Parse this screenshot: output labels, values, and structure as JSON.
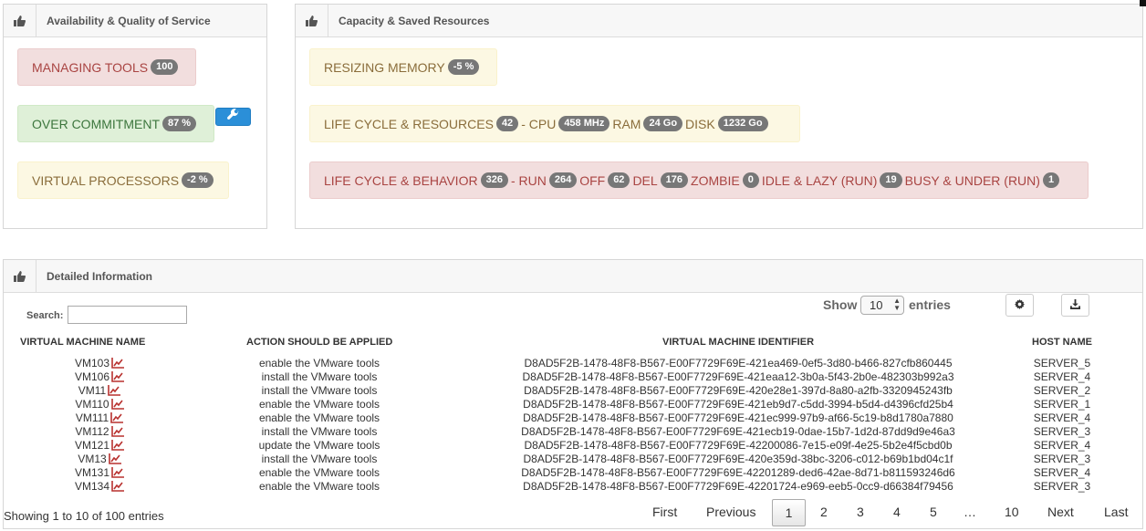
{
  "panels": {
    "availability_title": "Availability & Quality of Service",
    "capacity_title": "Capacity & Saved Resources",
    "detailed_title": "Detailed Information"
  },
  "availability": {
    "managing_tools_label": "MANAGING TOOLS",
    "managing_tools_value": "100",
    "over_commitment_label": "OVER COMMITMENT",
    "over_commitment_value": "87 %",
    "virtual_processors_label": "VIRTUAL PROCESSORS",
    "virtual_processors_value": "-2 %"
  },
  "capacity": {
    "resizing_memory_label": "RESIZING MEMORY",
    "resizing_memory_value": "-5 %",
    "lcr_label": "LIFE CYCLE & RESOURCES",
    "lcr_value": "42",
    "cpu_label": "- CPU",
    "cpu_value": "458 MHz",
    "ram_label": "RAM",
    "ram_value": "24 Go",
    "disk_label": "DISK",
    "disk_value": "1232 Go",
    "lcb_label": "LIFE CYCLE & BEHAVIOR",
    "lcb_value": "326",
    "run_label": "- RUN",
    "run_value": "264",
    "off_label": "OFF",
    "off_value": "62",
    "del_label": "DEL",
    "del_value": "176",
    "zombie_label": "ZOMBIE",
    "zombie_value": "0",
    "idle_label": "IDLE & LAZY (RUN)",
    "idle_value": "19",
    "busy_label": "BUSY & UNDER (RUN)",
    "busy_value": "1"
  },
  "controls": {
    "search_label": "Search:",
    "show_label": "Show",
    "page_size": "10",
    "entries_label": "entries"
  },
  "table": {
    "headers": [
      "VIRTUAL MACHINE NAME",
      "ACTION SHOULD BE APPLIED",
      "VIRTUAL MACHINE IDENTIFIER",
      "HOST NAME"
    ],
    "rows": [
      [
        "VM103",
        "enable the VMware tools",
        "D8AD5F2B-1478-48F8-B567-E00F7729F69E-421ea469-0ef5-3d80-b466-827cfb860445",
        "SERVER_5"
      ],
      [
        "VM106",
        "install the VMware tools",
        "D8AD5F2B-1478-48F8-B567-E00F7729F69E-421eaa12-3b0a-5f43-2b0e-482303b992a3",
        "SERVER_4"
      ],
      [
        "VM11",
        "install the VMware tools",
        "D8AD5F2B-1478-48F8-B567-E00F7729F69E-420e28e1-397d-8a80-a2fb-3320945243fb",
        "SERVER_2"
      ],
      [
        "VM110",
        "enable the VMware tools",
        "D8AD5F2B-1478-48F8-B567-E00F7729F69E-421eb9d7-c5dd-3994-b5d4-d4396cfd25b4",
        "SERVER_1"
      ],
      [
        "VM111",
        "enable the VMware tools",
        "D8AD5F2B-1478-48F8-B567-E00F7729F69E-421ec999-97b9-af66-5c19-b8d1780a7880",
        "SERVER_4"
      ],
      [
        "VM112",
        "install the VMware tools",
        "D8AD5F2B-1478-48F8-B567-E00F7729F69E-421ecb19-0dae-15b7-1d2d-87dd9d9e46a3",
        "SERVER_3"
      ],
      [
        "VM121",
        "update the VMware tools",
        "D8AD5F2B-1478-48F8-B567-E00F7729F69E-42200086-7e15-e09f-4e25-5b2e4f5cbd0b",
        "SERVER_4"
      ],
      [
        "VM13",
        "install the VMware tools",
        "D8AD5F2B-1478-48F8-B567-E00F7729F69E-420e359d-38bc-3206-c012-b69b1bd04c1f",
        "SERVER_3"
      ],
      [
        "VM131",
        "enable the VMware tools",
        "D8AD5F2B-1478-48F8-B567-E00F7729F69E-42201289-ded6-42ae-8d71-b811593246d6",
        "SERVER_4"
      ],
      [
        "VM134",
        "enable the VMware tools",
        "D8AD5F2B-1478-48F8-B567-E00F7729F69E-42201724-e969-eeb5-0cc9-d66384f79456",
        "SERVER_3"
      ]
    ]
  },
  "pagination": {
    "info": "Showing 1 to 10 of 100 entries",
    "first": "First",
    "previous": "Previous",
    "current": "1",
    "p2": "2",
    "p3": "3",
    "p4": "4",
    "p5": "5",
    "ellipsis": "…",
    "p10": "10",
    "next": "Next",
    "last": "Last"
  },
  "colors": {
    "danger": "#a94442",
    "success": "#3c763d",
    "warning": "#8a6d3b",
    "primary": "#2b8fd8",
    "trend": "#b8312f"
  },
  "icons": {
    "panel": "thumbs-up-icon",
    "tool": "wrench-icon",
    "settings": "gear-icon",
    "export": "download-icon",
    "row": "trend-chart-icon"
  }
}
